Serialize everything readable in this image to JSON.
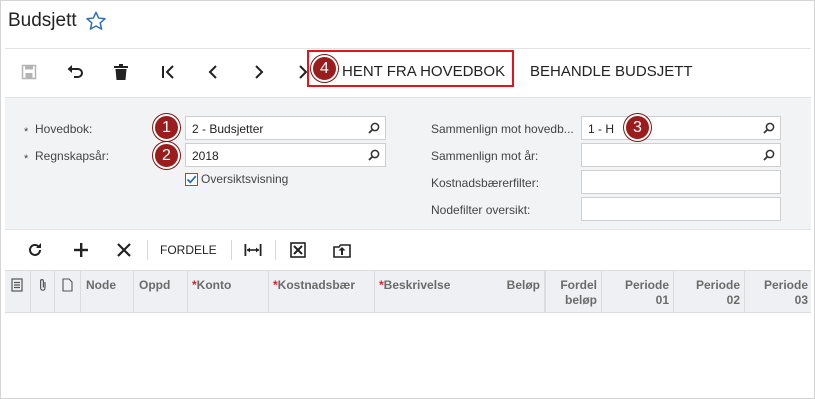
{
  "page": {
    "title": "Budsjett"
  },
  "toolbar": {
    "hent_label": "HENT FRA HOVEDBOK",
    "behandle_label": "BEHANDLE BUDSJETT"
  },
  "callouts": [
    "1",
    "2",
    "3",
    "4"
  ],
  "form": {
    "required_mark": "*",
    "hovedbok_label": "Hovedbok:",
    "hovedbok_value": "2 - Budsjetter",
    "regnskapsar_label": "Regnskapsår:",
    "regnskapsar_value": "2018",
    "oversikt_label": "Oversiktsvisning",
    "oversikt_checked": true,
    "sammenlign_hovedbok_label": "Sammenlign mot hovedb...",
    "sammenlign_hovedbok_value": "1 - H",
    "sammenlign_ar_label": "Sammenlign mot år:",
    "sammenlign_ar_value": "",
    "kostnadsbaerer_label": "Kostnadsbærerfilter:",
    "kostnadsbaerer_value": "",
    "nodefilter_label": "Nodefilter oversikt:",
    "nodefilter_value": ""
  },
  "grid_toolbar": {
    "fordele_label": "FORDELE"
  },
  "grid": {
    "columns": {
      "node": "Node",
      "oppd": "Oppd",
      "konto": "Konto",
      "kostnadsbaer": "Kostnadsbær",
      "beskrivelse": "Beskrivelse",
      "belop": "Beløp",
      "fordelt_1": "Fordel",
      "fordelt_2": "beløp",
      "periode01_1": "Periode",
      "periode01_2": "01",
      "periode02_1": "Periode",
      "periode02_2": "02",
      "periode03_1": "Periode",
      "periode03_2": "03"
    },
    "required_mark": "*"
  },
  "colors": {
    "accent": "#2a6ebb",
    "callout": "#9b1c1c",
    "highlight": "#e3141b",
    "required": "#d9261c"
  }
}
